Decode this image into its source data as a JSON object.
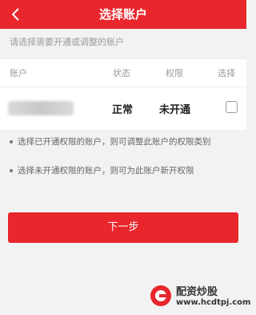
{
  "header": {
    "title": "选择账户",
    "back_icon": "chevron-left-icon"
  },
  "hint": "请选择需要开通或调整的账户",
  "table": {
    "columns": [
      "账户",
      "状态",
      "权限",
      "选择"
    ],
    "rows": [
      {
        "account": "",
        "status": "正常",
        "permission": "未开通",
        "selected": false
      }
    ]
  },
  "notes": [
    "选择已开通权限的账户，则可调整此账户的权限类别",
    "选择未开通权限的账户，则可为此账户新开权限"
  ],
  "next_button": "下一步",
  "watermark": {
    "title": "配资炒股",
    "url": "www.hcdtpj.com"
  },
  "colors": {
    "primary": "#e8262c",
    "background": "#f2f2f2"
  }
}
